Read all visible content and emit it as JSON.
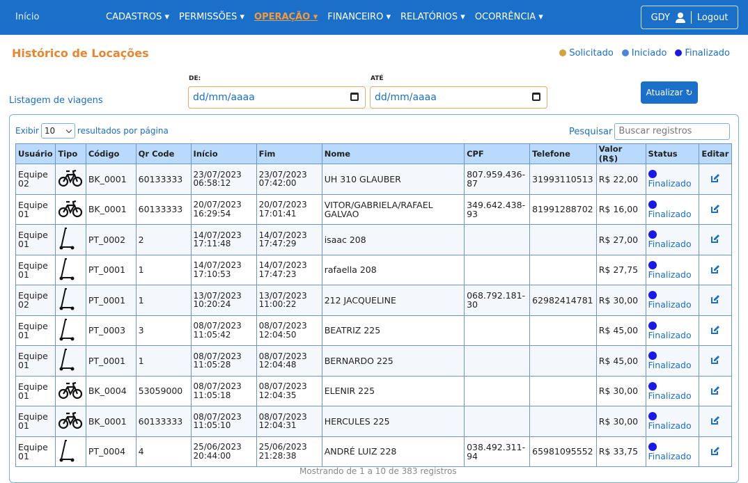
{
  "nav": {
    "home": "Início",
    "menus": [
      "CADASTROS ▾",
      "PERMISSÕES ▾",
      "OPERAÇÃO ▾",
      "FINANCEIRO ▾",
      "RELATÓRIOS ▾",
      "OCORRÊNCIA ▾"
    ],
    "active_menu": "OPERAÇÃO ▾",
    "user": "GDY",
    "logout": "Logout"
  },
  "page": {
    "title": "Histórico de Locações",
    "list_label": "Listagem de viagens"
  },
  "legend": [
    {
      "label": "Solicitado",
      "color": "#d4a23a"
    },
    {
      "label": "Iniciado",
      "color": "#4a86d8"
    },
    {
      "label": "Finalizado",
      "color": "#1a1ae8"
    }
  ],
  "filters": {
    "from_label": "DE:",
    "from_value": "dd/mm/aaaa",
    "to_label": "ATÉ",
    "to_value": "dd/mm/aaaa",
    "refresh_label": "Atualizar ↻"
  },
  "table_controls": {
    "show_label": "Exibir",
    "page_size": "10",
    "per_page_label": "resultados por página",
    "search_label": "Pesquisar",
    "search_placeholder": "Buscar registros"
  },
  "table": {
    "columns": [
      "Usuário",
      "Tipo",
      "Código",
      "Qr Code",
      "Início",
      "Fim",
      "Nome",
      "CPF",
      "Telefone",
      "Valor (R$)",
      "Status",
      "Editar"
    ],
    "rows": [
      {
        "user": "Equipe 02",
        "type": "bike-icon",
        "code": "BK_0001",
        "qr": "60133333",
        "start_date": "23/07/2023",
        "start_time": "06:58:12",
        "end_date": "23/07/2023",
        "end_time": "07:42:00",
        "name": "UH 310 GLAUBER",
        "cpf": "807.959.436-87",
        "phone": "31993110513",
        "value": "R$ 22,00",
        "status": "Finalizado"
      },
      {
        "user": "Equipe 01",
        "type": "bike-icon",
        "code": "BK_0001",
        "qr": "60133333",
        "start_date": "20/07/2023",
        "start_time": "16:29:54",
        "end_date": "20/07/2023",
        "end_time": "17:01:41",
        "name": "VITOR/GABRIELA/RAFAEL GALVAO",
        "cpf": "349.642.438-93",
        "phone": "81991288702",
        "value": "R$ 16,00",
        "status": "Finalizado"
      },
      {
        "user": "Equipe 01",
        "type": "scooter-icon",
        "code": "PT_0002",
        "qr": "2",
        "start_date": "14/07/2023",
        "start_time": "17:11:48",
        "end_date": "14/07/2023",
        "end_time": "17:47:29",
        "name": "isaac 208",
        "cpf": "",
        "phone": "",
        "value": "R$ 27,00",
        "status": "Finalizado"
      },
      {
        "user": "Equipe 01",
        "type": "scooter-icon",
        "code": "PT_0001",
        "qr": "1",
        "start_date": "14/07/2023",
        "start_time": "17:10:53",
        "end_date": "14/07/2023",
        "end_time": "17:47:23",
        "name": "rafaella 208",
        "cpf": "",
        "phone": "",
        "value": "R$ 27,75",
        "status": "Finalizado"
      },
      {
        "user": "Equipe 02",
        "type": "scooter-icon",
        "code": "PT_0001",
        "qr": "1",
        "start_date": "13/07/2023",
        "start_time": "10:20:24",
        "end_date": "13/07/2023",
        "end_time": "11:00:22",
        "name": "212 JACQUELINE",
        "cpf": "068.792.181-30",
        "phone": "62982414781",
        "value": "R$ 30,00",
        "status": "Finalizado"
      },
      {
        "user": "Equipe 01",
        "type": "scooter-icon",
        "code": "PT_0003",
        "qr": "3",
        "start_date": "08/07/2023",
        "start_time": "11:05:42",
        "end_date": "08/07/2023",
        "end_time": "12:04:50",
        "name": "BEATRIZ 225",
        "cpf": "",
        "phone": "",
        "value": "R$ 45,00",
        "status": "Finalizado"
      },
      {
        "user": "Equipe 01",
        "type": "scooter-icon",
        "code": "PT_0001",
        "qr": "1",
        "start_date": "08/07/2023",
        "start_time": "11:05:28",
        "end_date": "08/07/2023",
        "end_time": "12:04:48",
        "name": "BERNARDO 225",
        "cpf": "",
        "phone": "",
        "value": "R$ 45,00",
        "status": "Finalizado"
      },
      {
        "user": "Equipe 01",
        "type": "bike-icon",
        "code": "BK_0004",
        "qr": "53059000",
        "start_date": "08/07/2023",
        "start_time": "11:05:18",
        "end_date": "08/07/2023",
        "end_time": "12:04:35",
        "name": "ELENIR 225",
        "cpf": "",
        "phone": "",
        "value": "R$ 30,00",
        "status": "Finalizado"
      },
      {
        "user": "Equipe 01",
        "type": "bike-icon",
        "code": "BK_0001",
        "qr": "60133333",
        "start_date": "08/07/2023",
        "start_time": "11:05:10",
        "end_date": "08/07/2023",
        "end_time": "12:04:31",
        "name": "HERCULES 225",
        "cpf": "",
        "phone": "",
        "value": "R$ 30,00",
        "status": "Finalizado"
      },
      {
        "user": "Equipe 01",
        "type": "scooter-icon",
        "code": "PT_0004",
        "qr": "4",
        "start_date": "25/06/2023",
        "start_time": "20:44:00",
        "end_date": "25/06/2023",
        "end_time": "21:28:38",
        "name": "ANDRÉ LUIZ 228",
        "cpf": "038.492.311-94",
        "phone": "65981095552",
        "value": "R$ 33,75",
        "status": "Finalizado"
      }
    ]
  },
  "footer_text": "Mostrando de 1 a 10 de 383 registros"
}
